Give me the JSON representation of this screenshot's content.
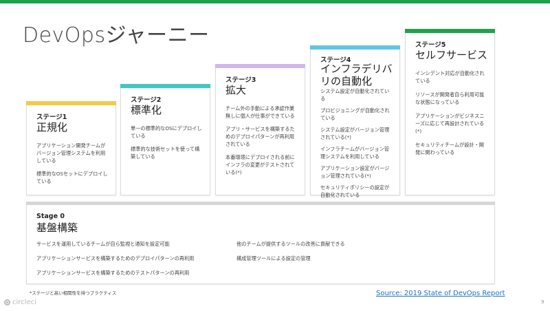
{
  "colors": {
    "top_bar": "#1ea34a",
    "stage1": "#f6c84b",
    "stage2": "#3fc8c2",
    "stage3": "#d1b5ee",
    "stage4": "#5fc4e8",
    "stage5": "#1ea34a",
    "stage0": "#d6d6d6"
  },
  "title": "DevOpsジャーニー",
  "stages": [
    {
      "label": "ステージ1",
      "name": "正規化",
      "items": [
        "アプリケーション開発チームがバージョン管理システムを利用している",
        "標準的なOSセットにデプロイしている"
      ]
    },
    {
      "label": "ステージ2",
      "name": "標準化",
      "items": [
        "単一の標準的なOSにデプロイしている",
        "標準的な技術セットを使って構築している"
      ]
    },
    {
      "label": "ステージ3",
      "name": "拡大",
      "items": [
        "チーム外の手動による承認作業無しに個人が仕事ができている",
        "アプリ・サービスを構築するためのデプロイパターンが再利用されている",
        "本番環境にデプロイされる前にインフラの変更がテストされている(*)"
      ]
    },
    {
      "label": "ステージ4",
      "name": "インフラデリバリの自動化",
      "items": [
        "システム設定が自動化されている",
        "プロビジョニングが自動化されている",
        "システム設定がバージョン管理されている(*)",
        "インフラチームがバージョン管理システムを利用している",
        "アプリケーション設定がバージョン管理されている(*)",
        "セキュリティポリシーの設定が自動化されている"
      ]
    },
    {
      "label": "ステージ5",
      "name": "セルフサービス",
      "items": [
        "インシデント対応が自動化されている",
        "リソースが開発者自ら利用可能な状態になっている",
        "アプリケーションがビジネスニーズに応じて再設計されている(*)",
        "セキュリティチームが設計・開発に関わっている"
      ]
    }
  ],
  "stage0": {
    "label": "Stage 0",
    "name": "基盤構築",
    "left_items": [
      "サービスを運用しているチームが自ら監視と通知を設定可能",
      "アプリケーションサービスを構築するためのデプロイパターンの再利用",
      "アプリケーションサービスを構築するためのテストパターンの再利用"
    ],
    "right_items": [
      "他のチームが提供するツールの改善に貢献できる",
      "構成管理ツールによる設定の管理"
    ]
  },
  "footnote": "*ステージと高い相関性を持つプラクティス",
  "source_link": "Source: 2019 State of DevOps Report",
  "logo_text": "circleci",
  "page_number": "9"
}
